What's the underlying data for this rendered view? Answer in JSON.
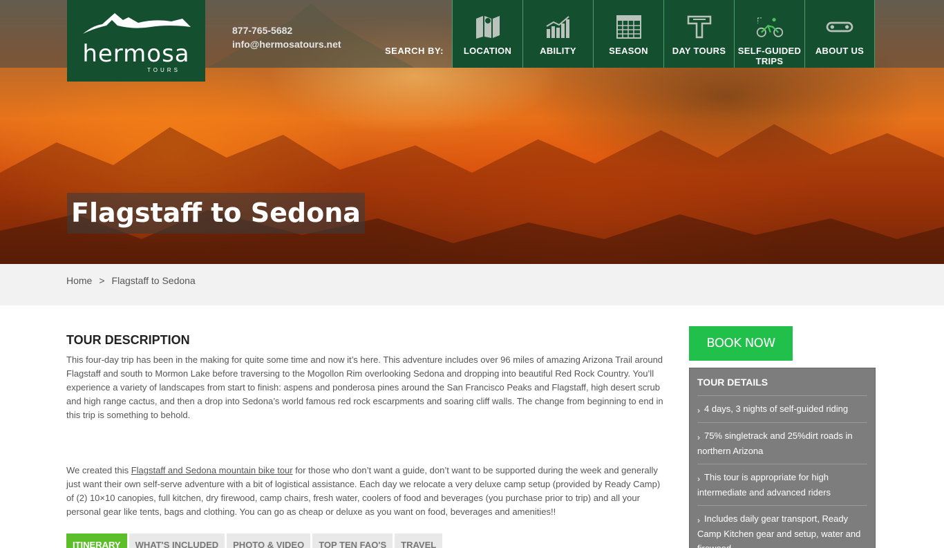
{
  "header": {
    "logo": {
      "name": "hermosa",
      "sub": "TOURS"
    },
    "phone": "877-765-5682",
    "email": "info@hermosatours.net",
    "search_by": "SEARCH BY:"
  },
  "nav": {
    "items": [
      {
        "label": "LOCATION",
        "icon": "map-icon"
      },
      {
        "label": "ABILITY",
        "icon": "bar-chart-icon"
      },
      {
        "label": "SEASON",
        "icon": "calendar-icon"
      },
      {
        "label": "DAY TOURS",
        "icon": "day-tour-icon"
      },
      {
        "label": "SELF-GUIDED TRIPS",
        "icon": "cyclist-icon"
      },
      {
        "label": "ABOUT US",
        "icon": "bike-chain-icon"
      }
    ]
  },
  "hero": {
    "title": "Flagstaff to Sedona"
  },
  "breadcrumb": {
    "home": "Home",
    "separator": ">",
    "current": "Flagstaff to Sedona"
  },
  "tour": {
    "section_title": "TOUR DESCRIPTION",
    "para1": "This four-day trip has been in the making for quite some time and now it’s here.  This adventure includes over 96 miles of amazing Arizona Trail around Flagstaff and south to Mormon Lake before traversing to the Mogollon Rim overlooking Sedona and dropping into beautiful Red Rock Country. You’ll experience a variety of landscapes from start to finish: aspens and ponderosa pines around the San Francisco Peaks and Flagstaff, high desert scrub and high range cactus, and then a drop into Sedona’s world famous red rock escarpments and soaring cliff walls. The change from beginning to end in this trip is something to behold.",
    "para2_before": "We created this ",
    "para2_link": "Flagstaff and Sedona mountain bike tour",
    "para2_after": " for those who don’t want a guide, don’t want to be supported during the week and generally just want their own self-serve adventure with a bit of logistical assistance. Each day we relocate a very deluxe camp setup (provided by Ready Camp) of (2) 10×10 canopies, full kitchen, dry firewood, camp chairs, fresh water, coolers of food and beverages (you purchase prior to trip) and all your personal gear like tents, bags and clothing. You can go as cheap or deluxe as you want on food, beverages and amenities!!"
  },
  "tabs": [
    {
      "label": "ITINERARY",
      "active": true
    },
    {
      "label": "WHAT'S INCLUDED",
      "active": false
    },
    {
      "label": "PHOTO & VIDEO",
      "active": false
    },
    {
      "label": "TOP TEN FAQ'S",
      "active": false
    },
    {
      "label": "TRAVEL",
      "active": false
    }
  ],
  "sidebar": {
    "book_now": "BOOK NOW",
    "details_title": "TOUR DETAILS",
    "details": [
      "4 days, 3 nights of self-guided riding",
      "75% singletrack and 25%dirt roads in northern Arizona",
      "This tour is appropriate for high intermediate and advanced riders",
      "Includes daily gear transport, Ready Camp Kitchen gear and setup, water and firewood"
    ]
  },
  "colors": {
    "brand_dark_green": "#14502f",
    "book_green": "#21c04a",
    "tab_active_green": "#5cbf2a",
    "details_gray": "#7d7d7d"
  }
}
